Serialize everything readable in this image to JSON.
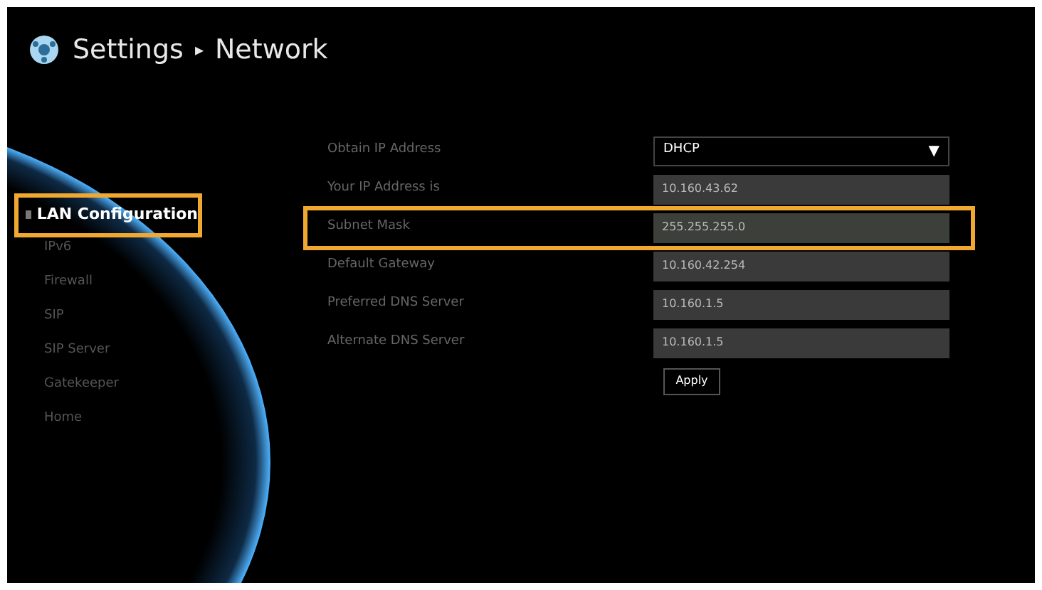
{
  "header": {
    "section": "Settings",
    "separator": "▸",
    "page": "Network"
  },
  "sidebar": {
    "items": [
      {
        "label": "LAN Configuration",
        "selected": true,
        "highlighted": true
      },
      {
        "label": "IPv6",
        "selected": false,
        "highlighted": false
      },
      {
        "label": "Firewall",
        "selected": false,
        "highlighted": false
      },
      {
        "label": "SIP",
        "selected": false,
        "highlighted": false
      },
      {
        "label": "SIP Server",
        "selected": false,
        "highlighted": false
      },
      {
        "label": "Gatekeeper",
        "selected": false,
        "highlighted": false
      },
      {
        "label": "Home",
        "selected": false,
        "highlighted": false
      }
    ]
  },
  "form": {
    "rows": [
      {
        "kind": "dropdown",
        "label": "Obtain IP Address",
        "value": "DHCP",
        "caret": "▼",
        "highlighted": false
      },
      {
        "kind": "field",
        "label": "Your IP Address is",
        "value": "10.160.43.62",
        "highlighted": false
      },
      {
        "kind": "field",
        "label": "Subnet Mask",
        "value": "255.255.255.0",
        "highlighted": true
      },
      {
        "kind": "field",
        "label": "Default Gateway",
        "value": "10.160.42.254",
        "highlighted": false
      },
      {
        "kind": "field",
        "label": "Preferred DNS Server",
        "value": "10.160.1.5",
        "highlighted": false
      },
      {
        "kind": "field",
        "label": "Alternate DNS Server",
        "value": "10.160.1.5",
        "highlighted": false
      }
    ],
    "apply": "Apply"
  }
}
